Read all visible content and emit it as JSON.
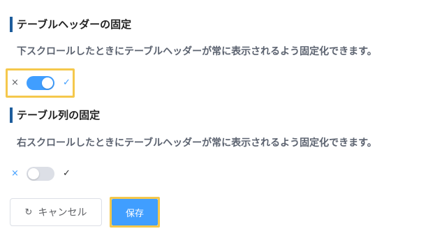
{
  "sections": [
    {
      "title": "テーブルヘッダーの固定",
      "description": "下スクロールしたときにテーブルヘッダーが常に表示されるよう固定化できます。",
      "toggle": {
        "off_glyph": "×",
        "on_glyph": "✓",
        "state": "on"
      }
    },
    {
      "title": "テーブル列の固定",
      "description": "右スクロールしたときにテーブルヘッダーが常に表示されるよう固定化できます。",
      "toggle": {
        "off_glyph": "×",
        "on_glyph": "✓",
        "state": "off"
      }
    }
  ],
  "buttons": {
    "cancel_label": "キャンセル",
    "cancel_icon": "↻",
    "save_label": "保存"
  },
  "colors": {
    "accent": "#409eff",
    "section_bar": "#1e5d9c",
    "highlight": "#f5c84c",
    "toggle_off": "#dcdfe6"
  }
}
